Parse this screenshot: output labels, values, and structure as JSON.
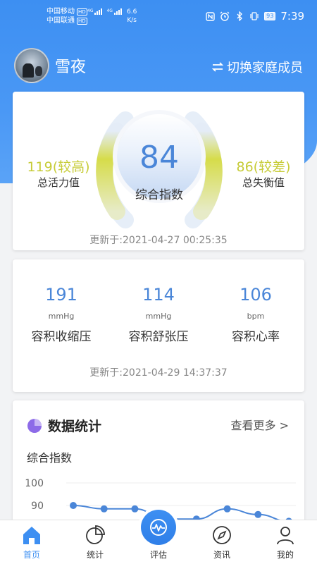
{
  "status_bar": {
    "carrier1": "中国移动",
    "carrier2": "中国联通",
    "hd": "HD",
    "net": "4G",
    "speed_value": "6.6",
    "speed_unit": "K/s",
    "battery": "93",
    "time": "7:39"
  },
  "profile": {
    "username": "雪夜",
    "switch_label": "切换家庭成员"
  },
  "overview": {
    "score": "84",
    "score_label": "综合指数",
    "left_value": "119(较高)",
    "left_label": "总活力值",
    "right_value": "86(较差)",
    "right_label": "总失衡值",
    "updated": "更新于:2021-04-27 00:25:35",
    "gauge_color": "#d6dc4a"
  },
  "blood_pressure": {
    "items": [
      {
        "value": "191",
        "unit": "mmHg",
        "label": "容积收缩压"
      },
      {
        "value": "114",
        "unit": "mmHg",
        "label": "容积舒张压"
      },
      {
        "value": "106",
        "unit": "bpm",
        "label": "容积心率"
      }
    ],
    "updated": "更新于:2021-04-29 14:37:37",
    "accent": "#4a86d8"
  },
  "stats": {
    "title": "数据统计",
    "more": "查看更多 >",
    "subtitle": "综合指数",
    "chart_data": {
      "type": "line",
      "title": "综合指数",
      "y_ticks": [
        "100",
        "90"
      ],
      "ylim": [
        80,
        100
      ],
      "series": [
        {
          "values": [
            90,
            88.5,
            88.5,
            84,
            84,
            88.5,
            86,
            83
          ]
        }
      ],
      "line_color": "#4a86d8"
    }
  },
  "tabbar": {
    "items": [
      {
        "label": "首页",
        "icon": "home-icon"
      },
      {
        "label": "统计",
        "icon": "pie-chart-icon"
      },
      {
        "label": "评估",
        "icon": "pulse-icon"
      },
      {
        "label": "资讯",
        "icon": "compass-icon"
      },
      {
        "label": "我的",
        "icon": "user-icon"
      }
    ],
    "active_color": "#3d8ff2"
  }
}
